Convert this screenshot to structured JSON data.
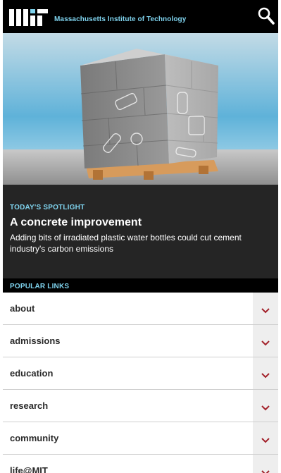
{
  "header": {
    "logo_text": "MIT",
    "org_name": "Massachusetts Institute of Technology",
    "search_icon": "search-icon"
  },
  "hero": {
    "image_subject": "concrete-block-cube-on-pallet"
  },
  "spotlight": {
    "kicker": "TODAY'S SPOTLIGHT",
    "title": "A concrete improvement",
    "description": "Adding bits of irradiated plastic water bottles could cut cement industry's carbon emissions"
  },
  "popular": {
    "heading": "POPULAR LINKS",
    "items": [
      {
        "label": "about"
      },
      {
        "label": "admissions"
      },
      {
        "label": "education"
      },
      {
        "label": "research"
      },
      {
        "label": "community"
      },
      {
        "label": "life@MIT"
      }
    ],
    "toggle_icon": "chevron-down-icon"
  },
  "colors": {
    "accent": "#7fd3ee",
    "chevron": "#a3222b",
    "spotlight_bg": "#252525",
    "header_bg": "#000000"
  }
}
